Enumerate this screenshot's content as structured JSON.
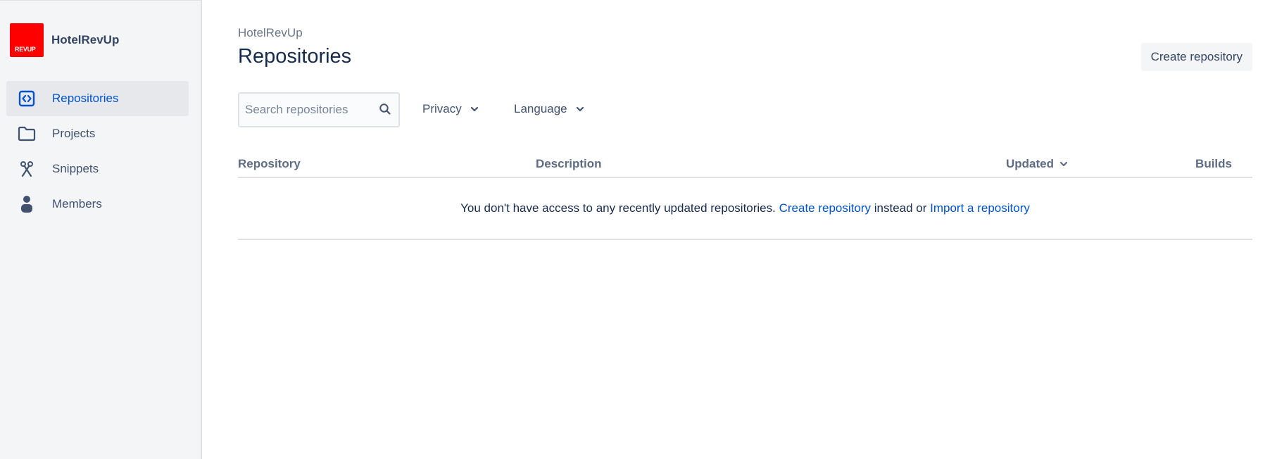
{
  "sidebar": {
    "workspace_name": "HotelRevUp",
    "logo_text": "REVUP",
    "logo_color": "#ff0000",
    "items": [
      {
        "label": "Repositories",
        "icon": "code-icon",
        "active": true
      },
      {
        "label": "Projects",
        "icon": "folder-icon",
        "active": false
      },
      {
        "label": "Snippets",
        "icon": "scissors-icon",
        "active": false
      },
      {
        "label": "Members",
        "icon": "person-icon",
        "active": false
      }
    ]
  },
  "header": {
    "breadcrumb": "HotelRevUp",
    "title": "Repositories",
    "create_button": "Create repository"
  },
  "filters": {
    "search_placeholder": "Search repositories",
    "privacy": "Privacy",
    "language": "Language"
  },
  "table": {
    "columns": {
      "repository": "Repository",
      "description": "Description",
      "updated": "Updated",
      "builds": "Builds"
    },
    "empty": {
      "text_before": "You don't have access to any recently updated repositories.",
      "create_link": "Create repository",
      "middle": "instead or",
      "import_link": "Import a repository"
    }
  },
  "colors": {
    "accent": "#0052cc",
    "sidebar_bg": "#f4f5f7",
    "text": "#172b4d"
  }
}
